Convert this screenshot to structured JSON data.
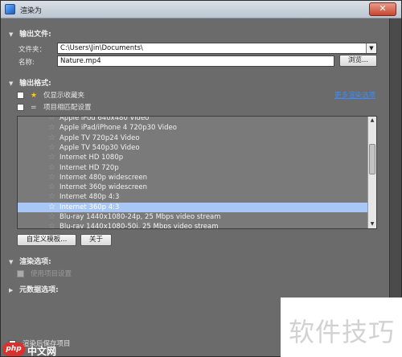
{
  "window": {
    "title": "渲染为",
    "close_glyph": "✕"
  },
  "output_file": {
    "heading": "输出文件:",
    "folder_label": "文件夹：",
    "folder_value": "C:\\Users\\Jin\\Documents\\",
    "name_label": "名称:",
    "name_value": "Nature.mp4",
    "browse_label": "浏览..."
  },
  "output_format": {
    "heading": "输出格式:",
    "favorites_label": "仅显示收藏夹",
    "match_project_label": "项目相匹配设置",
    "more_link": "更多渲染选项"
  },
  "format_list": {
    "items": [
      {
        "label": "Apple iPod 640x480 Video",
        "selected": false
      },
      {
        "label": "Apple iPad/iPhone 4 720p30 Video",
        "selected": false
      },
      {
        "label": "Apple TV 720p24 Video",
        "selected": false
      },
      {
        "label": "Apple TV 540p30 Video",
        "selected": false
      },
      {
        "label": "Internet HD 1080p",
        "selected": false
      },
      {
        "label": "Internet HD 720p",
        "selected": false
      },
      {
        "label": "Internet 480p widescreen",
        "selected": false
      },
      {
        "label": "Internet 360p widescreen",
        "selected": false
      },
      {
        "label": "Internet 480p 4:3",
        "selected": false
      },
      {
        "label": "Internet 360p 4:3",
        "selected": true
      },
      {
        "label": "Blu-ray 1440x1080-24p, 25 Mbps video stream",
        "selected": false
      },
      {
        "label": "Blu-ray 1440x1080-50i, 25 Mbps video stream",
        "selected": false
      }
    ]
  },
  "buttons": {
    "customize": "自定义模板...",
    "about": "关于"
  },
  "render_options": {
    "heading": "渲染选项:",
    "disabled_option": "使用项目设置"
  },
  "metadata": {
    "heading": "元数据选项:"
  },
  "footer": {
    "checkbox_label": "渲染后保存项目"
  },
  "watermark": {
    "text": "软件技巧",
    "site_logo": "php",
    "site_text": "中文网"
  },
  "colors": {
    "selection": "#a9c7f5",
    "link": "#3a8cff",
    "close": "#c6452e"
  }
}
